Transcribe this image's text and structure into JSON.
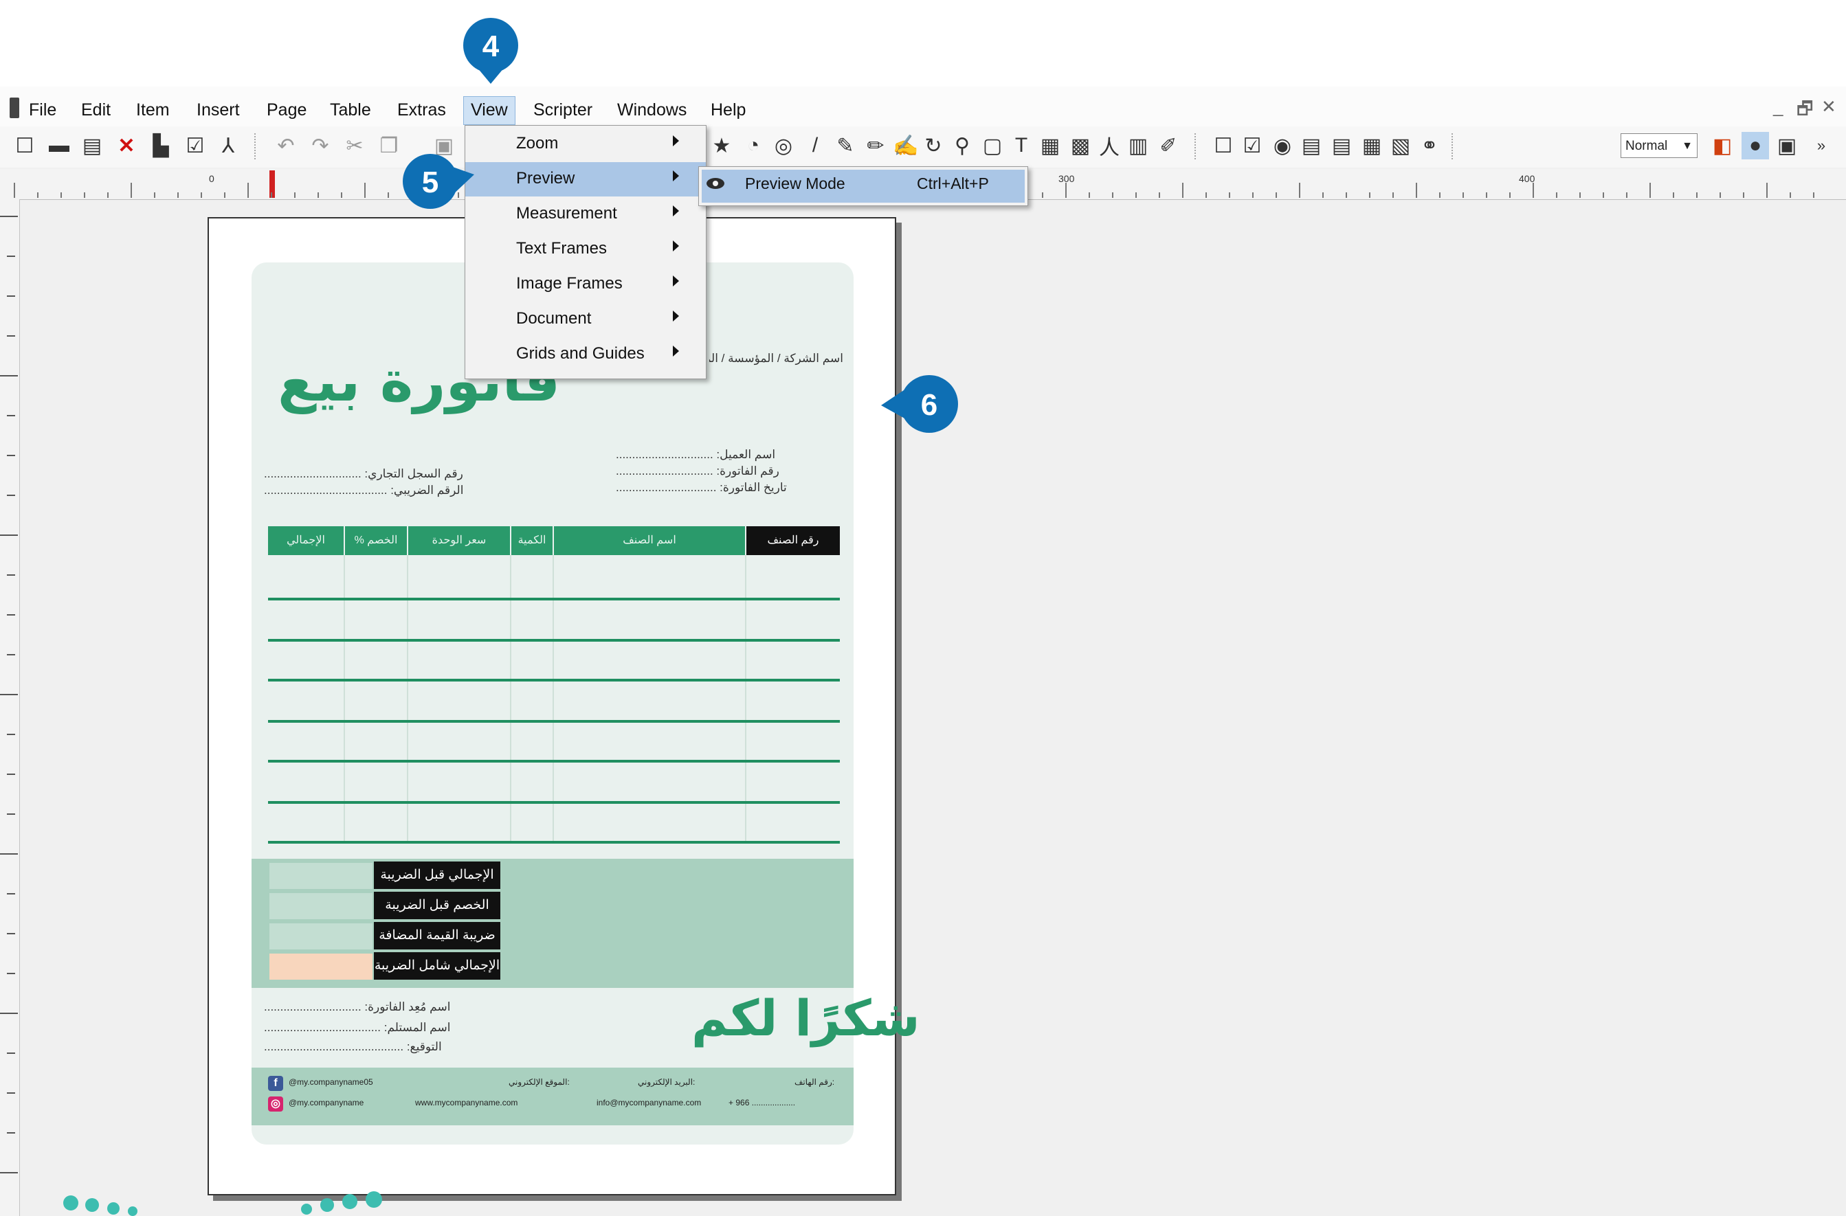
{
  "menubar": {
    "items": [
      "File",
      "Edit",
      "Item",
      "Insert",
      "Page",
      "Table",
      "Extras",
      "View",
      "Scripter",
      "Windows",
      "Help"
    ],
    "active": "View",
    "window_controls": [
      "_",
      "🗗",
      "✕"
    ]
  },
  "toolbar": {
    "mode_select": "Normal"
  },
  "ruler": {
    "labels": [
      "0",
      "300",
      "400"
    ]
  },
  "view_menu": {
    "items": [
      {
        "label": "Zoom"
      },
      {
        "label": "Preview"
      },
      {
        "label": "Measurement"
      },
      {
        "label": "Text Frames"
      },
      {
        "label": "Image Frames"
      },
      {
        "label": "Document"
      },
      {
        "label": "Grids and Guides"
      }
    ],
    "highlighted": "Preview"
  },
  "preview_submenu": {
    "label": "Preview Mode",
    "shortcut": "Ctrl+Alt+P"
  },
  "callouts": {
    "view_step": "4",
    "preview_step": "5",
    "page_step": "6"
  },
  "invoice": {
    "company_line": "اسم الشركة / المؤسسة / المتجر",
    "title": "فاتورة بيع",
    "customer_fields": [
      "اسم العميل: ..............................",
      "رقم الفاتورة: ..............................",
      "تاريخ الفاتورة: ..............................."
    ],
    "reg_fields": [
      "رقم السجل التجاري: ..............................",
      "الرقم الضريبي: ......................................"
    ],
    "table_headers": [
      "رقم الصنف",
      "اسم الصنف",
      "الكمية",
      "سعر الوحدة",
      "الخصم %",
      "الإجمالي"
    ],
    "totals": [
      "الإجمالي قبل الضريبة",
      "الخصم قبل الضريبة",
      "ضريبة القيمة المضافة",
      "الإجمالي شامل الضريبة"
    ],
    "thanks": "شكرًا لكم",
    "signature_fields": [
      "اسم مُعِد الفاتورة: ..............................",
      "اسم المستلم: ....................................",
      "التوقيع: ..........................................."
    ],
    "footer": {
      "phone_label": "رقم الهاتف:",
      "phone_value": "+ 966 ...................",
      "email_label": "البريد الإلكتروني:",
      "email_value": "info@mycompanyname.com",
      "site_label": "الموقع الإلكتروني:",
      "site_value": "www.mycompanyname.com",
      "facebook": "@my.companyname05",
      "instagram": "@my.companyname"
    }
  },
  "colors": {
    "accent_green": "#2a9a6b",
    "callout_blue": "#0e6fb4",
    "menu_highlight": "#aac6e6"
  }
}
